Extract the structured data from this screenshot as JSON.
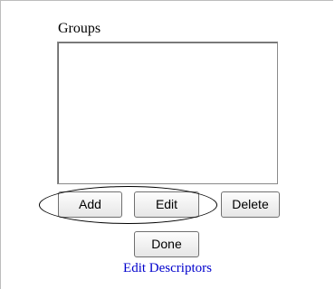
{
  "groups": {
    "label": "Groups",
    "items": []
  },
  "buttons": {
    "add": "Add",
    "edit": "Edit",
    "delete": "Delete",
    "done": "Done"
  },
  "links": {
    "edit_descriptors": "Edit Descriptors"
  }
}
